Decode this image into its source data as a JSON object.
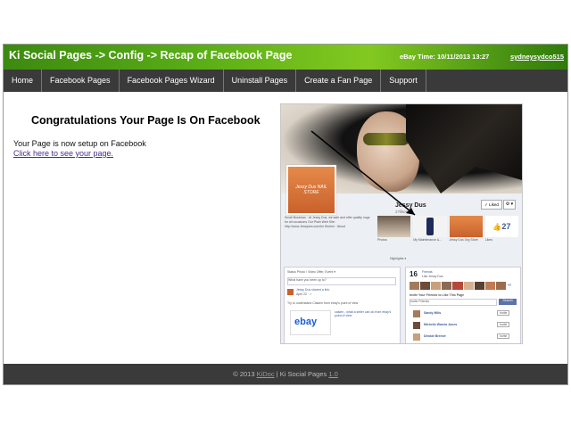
{
  "banner": {
    "title": "Ki Social Pages -> Config -> Recap of Facebook Page",
    "ebay_time": "eBay Time: 10/11/2013 13:27",
    "user": "sydneysydco515"
  },
  "nav": {
    "items": [
      "Home",
      "Facebook Pages",
      "Facebook Pages Wizard",
      "Uninstall Pages",
      "Create a Fan Page",
      "Support"
    ]
  },
  "main": {
    "heading": "Congratulations Your Page Is On Facebook",
    "message": "Your Page is now setup on Facebook",
    "link": "Click here to see your page."
  },
  "fb_preview": {
    "page_name": "Jessy Dus",
    "likes_label": "27likes",
    "liked_button": "✓ Liked",
    "gear_button": "⚙ ▾",
    "avatar_text": "Jessy Dus NAIL STORE",
    "info": "Small Business · At Jessy Dus, we sale and offer quality nogs for all occasions Our Plain Web Site: http://www.Jessydus.com/kn Stories · About",
    "thumb_labels": [
      "Photos",
      "My Maintenance &...",
      "Jessy Dus Org Store",
      "Likes"
    ],
    "like_count": "27",
    "highlights": "Highlights ▾",
    "composer_tabs": "Status   Photo / Video   Offer, Event ▾",
    "composer_placeholder": "What have you been up to?",
    "post_author": "Jessy Dus shared a link.",
    "post_date": "April 22 · ✓",
    "post_text": "Try to understand Clasien from ebay's point of view",
    "ebay_logo": "ebay",
    "ebay_caption": "casien - what a seller can do from ebay's point of view",
    "friends_count": "16",
    "friends_label": "Friends",
    "friends_sub": "Like Jessy Dus",
    "invite_title": "Invite Your Friends to Like This Page",
    "invite_placeholder": "Invite Friends",
    "search_button": "Search",
    "plus_count": "+7",
    "friends": [
      "Sandy Mills",
      "Michelle Warcia Jones",
      "Debbie Bremer"
    ],
    "invite_button": "Invite"
  },
  "footer": {
    "copyright": "© 2013",
    "company": "KiDoc",
    "product": "| Ki Social Pages",
    "version": "1.0"
  },
  "colors": {
    "banner_green": "#5aae16",
    "nav_bg": "#3a3a3a",
    "link_purple": "#4a2c8a",
    "fb_blue": "#3b5998"
  }
}
